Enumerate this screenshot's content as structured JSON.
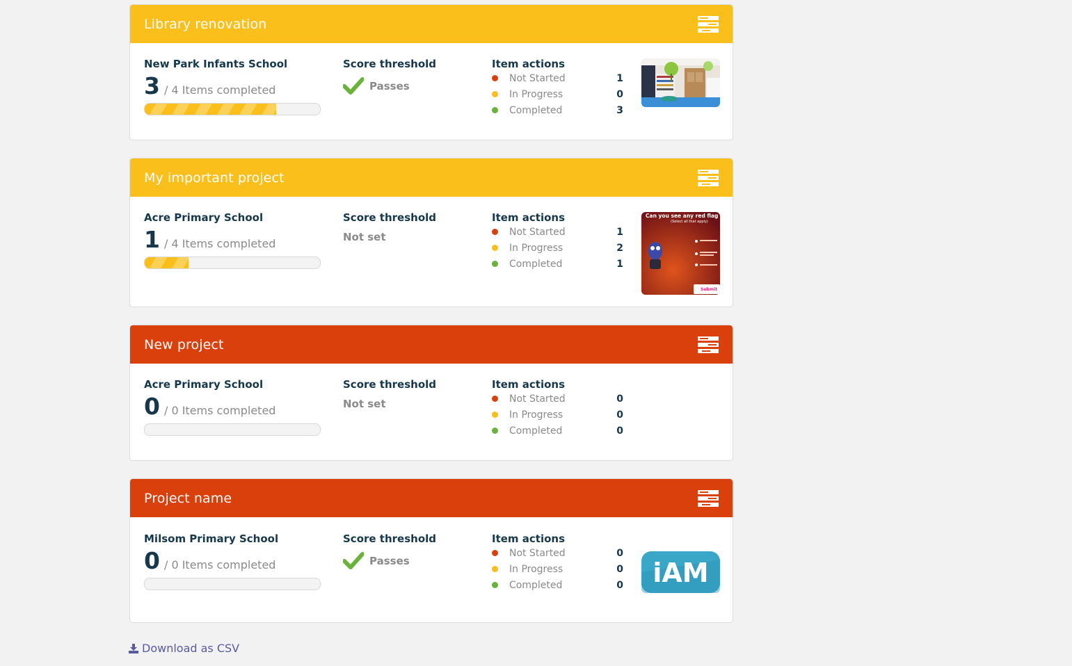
{
  "colors": {
    "yellow_header": "#fbbf1c",
    "red_header": "#d9400b",
    "not_started": "#d9400b",
    "in_progress": "#fbbf1c",
    "completed": "#6ab33a"
  },
  "cards": [
    {
      "title": "Library renovation",
      "header_color": "#fbbf1c",
      "school": "New Park Infants School",
      "completed_count": "3",
      "items_text": "/ 4 Items completed",
      "progress_fraction": 0.75,
      "threshold_title": "Score threshold",
      "threshold_status": "Passes",
      "actions_title": "Item actions",
      "actions": [
        {
          "label": "Not Started",
          "value": "1"
        },
        {
          "label": "In Progress",
          "value": "0"
        },
        {
          "label": "Completed",
          "value": "3"
        }
      ],
      "thumbnail": "library-photo"
    },
    {
      "title": "My important project",
      "header_color": "#fbbf1c",
      "school": "Acre Primary School",
      "completed_count": "1",
      "items_text": "/ 4 Items completed",
      "progress_fraction": 0.25,
      "threshold_title": "Score threshold",
      "threshold_status": "Not set",
      "actions_title": "Item actions",
      "actions": [
        {
          "label": "Not Started",
          "value": "1"
        },
        {
          "label": "In Progress",
          "value": "2"
        },
        {
          "label": "Completed",
          "value": "1"
        }
      ],
      "thumbnail": "quiz-screenshot",
      "thumbnail_text": {
        "heading": "Can you see any red flag",
        "sub": "(Select all that apply)",
        "button": "Submit"
      }
    },
    {
      "title": "New project",
      "header_color": "#d9400b",
      "school": "Acre Primary School",
      "completed_count": "0",
      "items_text": "/ 0 Items completed",
      "progress_fraction": 0,
      "threshold_title": "Score threshold",
      "threshold_status": "Not set",
      "actions_title": "Item actions",
      "actions": [
        {
          "label": "Not Started",
          "value": "0"
        },
        {
          "label": "In Progress",
          "value": "0"
        },
        {
          "label": "Completed",
          "value": "0"
        }
      ],
      "thumbnail": "none"
    },
    {
      "title": "Project name",
      "header_color": "#d9400b",
      "school": "Milsom Primary School",
      "completed_count": "0",
      "items_text": "/ 0 Items completed",
      "progress_fraction": 0,
      "threshold_title": "Score threshold",
      "threshold_status": "Passes",
      "actions_title": "Item actions",
      "actions": [
        {
          "label": "Not Started",
          "value": "0"
        },
        {
          "label": "In Progress",
          "value": "0"
        },
        {
          "label": "Completed",
          "value": "0"
        }
      ],
      "thumbnail": "iam-logo",
      "thumbnail_text": {
        "logo": "iAM"
      }
    }
  ],
  "download": {
    "label": "Download as CSV",
    "icon": "download-icon"
  }
}
